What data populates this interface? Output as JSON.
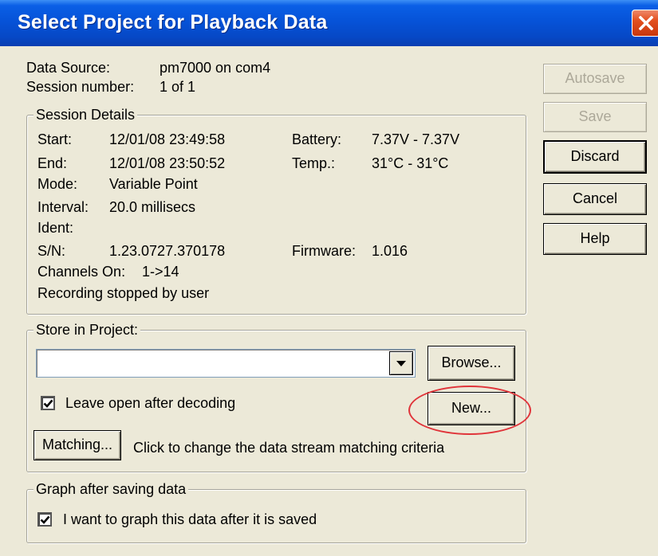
{
  "window": {
    "title": "Select Project for Playback Data",
    "title_bar_color": "#0653d8",
    "close_button_color": "#e3501f"
  },
  "info": {
    "data_source_label": "Data Source:",
    "data_source_value": "pm7000 on com4",
    "session_number_label": "Session number:",
    "session_number_value": "1 of 1"
  },
  "session_details": {
    "legend": "Session Details",
    "start_label": "Start:",
    "start_value": "12/01/08 23:49:58",
    "end_label": "End:",
    "end_value": "12/01/08 23:50:52",
    "mode_label": "Mode:",
    "mode_value": "Variable Point",
    "interval_label": "Interval:",
    "interval_value": "20.0 millisecs",
    "ident_label": "Ident:",
    "sn_label": "S/N:",
    "sn_value": "1.23.0727.370178",
    "battery_label": "Battery:",
    "battery_value": "7.37V - 7.37V",
    "temp_label": "Temp.:",
    "temp_value": "31°C - 31°C",
    "firmware_label": "Firmware:",
    "firmware_value": "1.016",
    "channels_label": "Channels On:",
    "channels_value": "1->14",
    "recording_status": "Recording stopped by user"
  },
  "store_project": {
    "legend": "Store in Project:",
    "project_value": "",
    "browse_label": "Browse...",
    "new_label": "New...",
    "leave_open_label": "Leave open after decoding",
    "leave_open_checked": true,
    "matching_label": "Matching...",
    "matching_hint": "Click to change the data stream matching criteria"
  },
  "graph": {
    "legend": "Graph after saving data",
    "graph_label": "I want to graph this data after it is saved",
    "graph_checked": true
  },
  "side_buttons": {
    "autosave": "Autosave",
    "save": "Save",
    "discard": "Discard",
    "cancel": "Cancel",
    "help": "Help"
  },
  "annotation_color": "#e0343a"
}
